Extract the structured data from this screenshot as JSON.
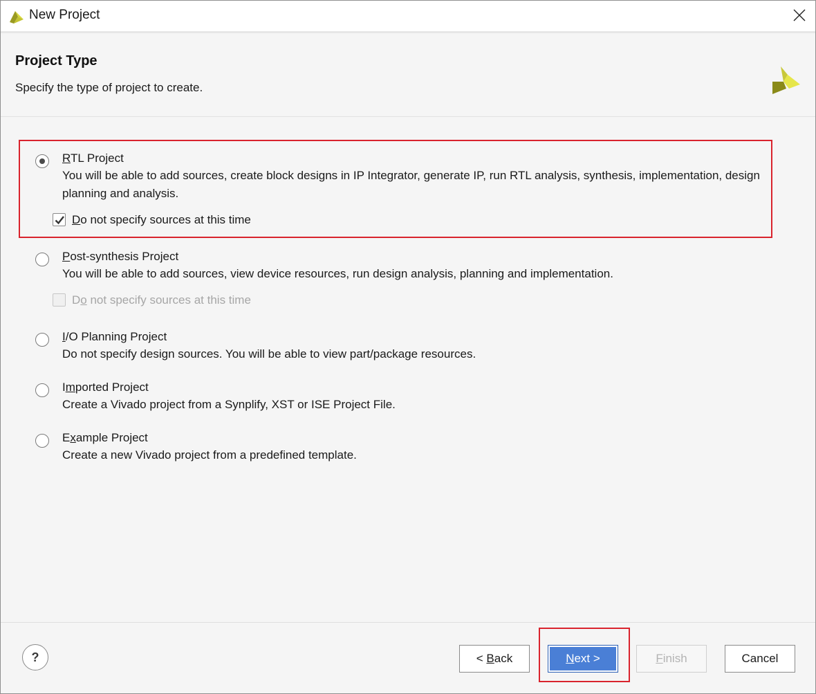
{
  "window": {
    "title": "New Project"
  },
  "header": {
    "title": "Project Type",
    "subtitle": "Specify the type of project to create."
  },
  "options": [
    {
      "title_first": "R",
      "title_rest": "TL Project",
      "description": "You will be able to add sources, create block designs in IP Integrator, generate IP, run RTL analysis, synthesis, implementation, design planning and analysis.",
      "selected": true,
      "checkbox": {
        "label_first": "D",
        "label_rest": "o not specify sources at this time",
        "checked": true,
        "enabled": true
      }
    },
    {
      "title_first": "P",
      "title_rest": "ost-synthesis Project",
      "description": "You will be able to add sources, view device resources, run design analysis, planning and implementation.",
      "selected": false,
      "checkbox": {
        "label_pre": "D",
        "label_first": "o",
        "label_rest": " not specify sources at this time",
        "checked": false,
        "enabled": false
      }
    },
    {
      "title_first": "I",
      "title_rest": "/O Planning Project",
      "description": "Do not specify design sources. You will be able to view part/package resources.",
      "selected": false
    },
    {
      "title_pre": "I",
      "title_first": "m",
      "title_rest": "ported Project",
      "description": "Create a Vivado project from a Synplify, XST or ISE Project File.",
      "selected": false
    },
    {
      "title_pre": "E",
      "title_first": "x",
      "title_rest": "ample Project",
      "description": "Create a new Vivado project from a predefined template.",
      "selected": false
    }
  ],
  "footer": {
    "help_label": "?",
    "back_pre": "< ",
    "back_first": "B",
    "back_rest": "ack",
    "next_first": "N",
    "next_rest": "ext >",
    "finish_first": "F",
    "finish_rest": "inish",
    "cancel_label": "Cancel"
  },
  "colors": {
    "accent": "#4a7fd6",
    "highlight": "#d9232d",
    "logo_yellow": "#d9d93a",
    "logo_olive": "#8a8a18"
  },
  "icons": {
    "app": "vivado-logo-icon",
    "close": "close-icon",
    "help": "help-icon"
  }
}
